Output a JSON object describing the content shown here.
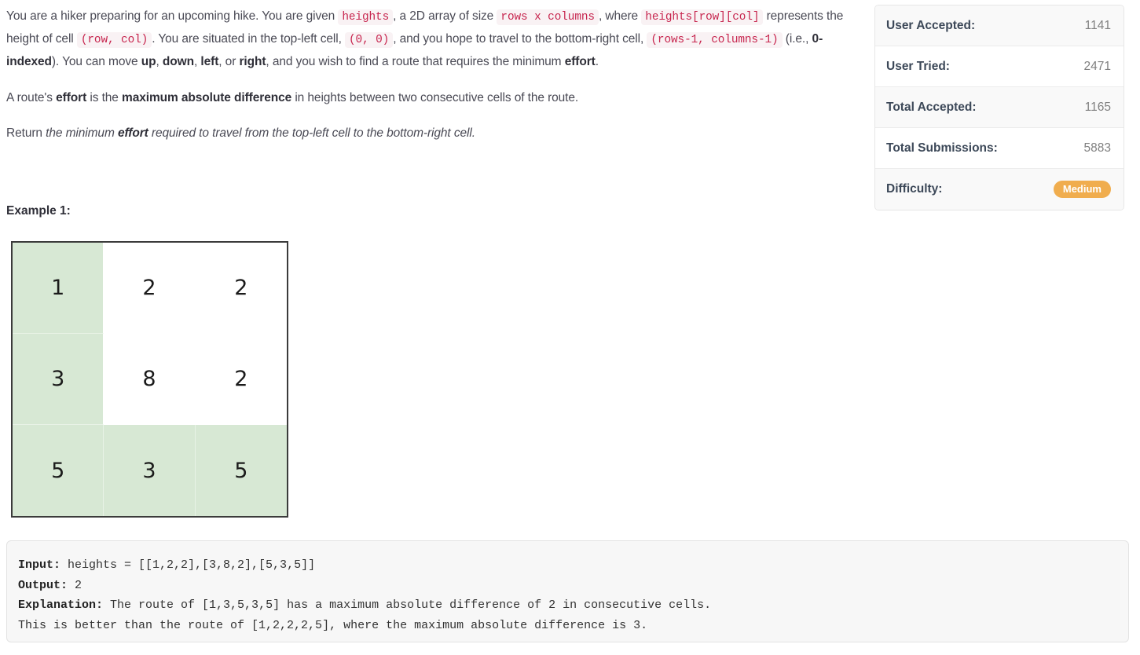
{
  "problem": {
    "paragraph1": {
      "seg1": "You are a hiker preparing for an upcoming hike. You are given ",
      "code1": "heights",
      "seg2": ", a 2D array of size ",
      "code2": "rows x columns",
      "seg3": ", where ",
      "code3": "heights[row][col]",
      "seg4": " represents the height of cell ",
      "code4": "(row, col)",
      "seg5": ". You are situated in the top-left cell, ",
      "code5": "(0, 0)",
      "seg6": ", and you hope to travel to the bottom-right cell, ",
      "code6": "(rows-1, columns-1)",
      "seg7": " (i.e., ",
      "bold1": "0-indexed",
      "seg8": "). You can move ",
      "bold2": "up",
      "seg9": ", ",
      "bold3": "down",
      "seg10": ", ",
      "bold4": "left",
      "seg11": ", or ",
      "bold5": "right",
      "seg12": ", and you wish to find a route that requires the minimum ",
      "bold6": "effort",
      "seg13": "."
    },
    "paragraph2": {
      "seg1": "A route's ",
      "bold1": "effort",
      "seg2": " is the ",
      "bold2": "maximum absolute difference",
      "seg3": " in heights between two consecutive cells of the route."
    },
    "paragraph3": {
      "seg1": "Return ",
      "italic1": "the minimum ",
      "italic_bold1": "effort",
      "italic2": " required to travel from the top-left cell to the bottom-right cell."
    },
    "example_title": "Example 1:"
  },
  "figure": {
    "rows": [
      [
        {
          "value": "1",
          "highlighted": true
        },
        {
          "value": "2",
          "highlighted": false
        },
        {
          "value": "2",
          "highlighted": false
        }
      ],
      [
        {
          "value": "3",
          "highlighted": true
        },
        {
          "value": "8",
          "highlighted": false
        },
        {
          "value": "2",
          "highlighted": false
        }
      ],
      [
        {
          "value": "5",
          "highlighted": true
        },
        {
          "value": "3",
          "highlighted": true
        },
        {
          "value": "5",
          "highlighted": true
        }
      ]
    ],
    "highlight_color": "#d7e8d4",
    "border_color": "#3b3b3b"
  },
  "example_block": {
    "input_label": "Input:",
    "input_value": " heights = [[1,2,2],[3,8,2],[5,3,5]]",
    "output_label": "Output:",
    "output_value": " 2",
    "explanation_label": "Explanation:",
    "explanation_value": " The route of [1,3,5,3,5] has a maximum absolute difference of 2 in consecutive cells.\nThis is better than the route of [1,2,2,2,5], where the maximum absolute difference is 3."
  },
  "stats": {
    "rows": [
      {
        "label": "User Accepted:",
        "value": "1141",
        "is_badge": false
      },
      {
        "label": "User Tried:",
        "value": "2471",
        "is_badge": false
      },
      {
        "label": "Total Accepted:",
        "value": "1165",
        "is_badge": false
      },
      {
        "label": "Total Submissions:",
        "value": "5883",
        "is_badge": false
      },
      {
        "label": "Difficulty:",
        "value": "Medium",
        "is_badge": true
      }
    ],
    "difficulty_color": "#f0ad4e"
  }
}
